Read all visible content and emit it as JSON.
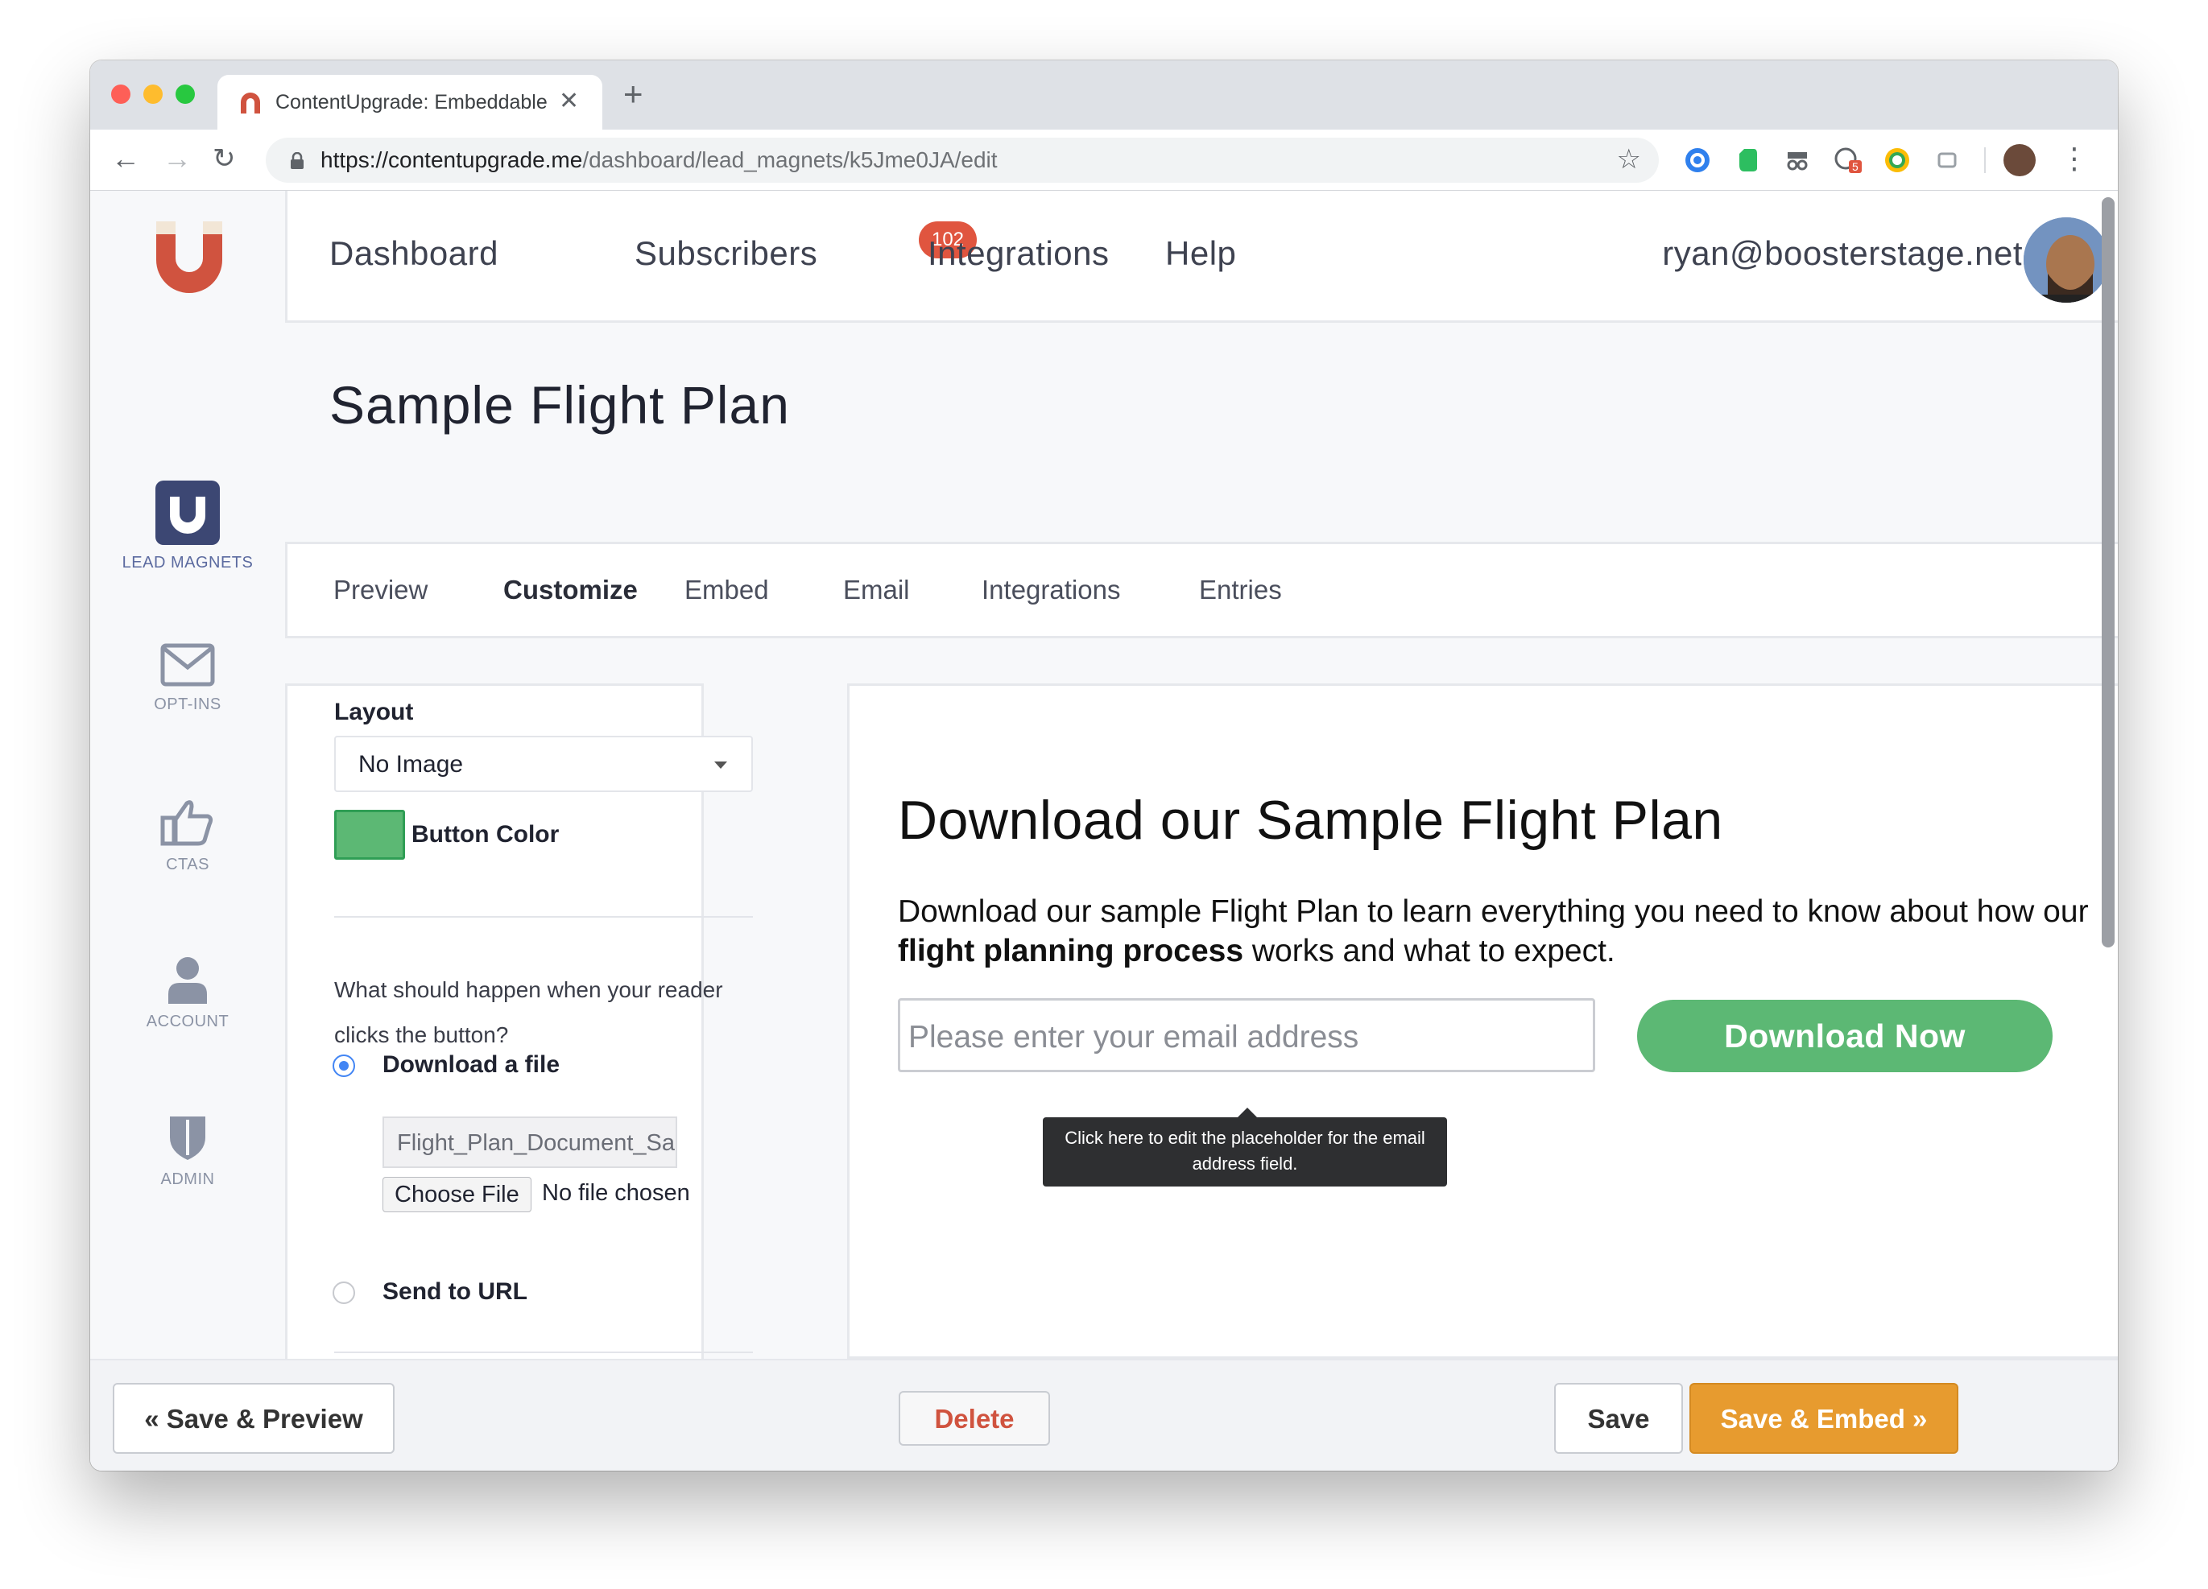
{
  "browser": {
    "tab_title": "ContentUpgrade: Embeddable",
    "url_host": "https://contentupgrade.me",
    "url_path": "/dashboard/lead_magnets/k5Jme0JA/edit",
    "extension_badge": "5"
  },
  "nav": {
    "dashboard": "Dashboard",
    "subscribers": "Subscribers",
    "subscribers_badge": "102",
    "integrations": "Integrations",
    "help": "Help",
    "user_email": "ryan@boosterstage.net"
  },
  "sidebar": {
    "items": [
      {
        "label": "LEAD MAGNETS",
        "icon": "magnet-icon"
      },
      {
        "label": "OPT-INS",
        "icon": "envelope-icon"
      },
      {
        "label": "CTAS",
        "icon": "thumbs-up-icon"
      },
      {
        "label": "ACCOUNT",
        "icon": "user-icon"
      },
      {
        "label": "ADMIN",
        "icon": "shield-icon"
      }
    ]
  },
  "page": {
    "title": "Sample Flight Plan",
    "tabs": [
      "Preview",
      "Customize",
      "Embed",
      "Email",
      "Integrations",
      "Entries"
    ],
    "active_tab": "Customize"
  },
  "settings": {
    "layout_label": "Layout",
    "layout_value": "No Image",
    "button_color_label": "Button Color",
    "button_color": "#5cb874",
    "question": "What should happen when your reader clicks the button?",
    "option_download": "Download a file",
    "file_value": "Flight_Plan_Document_Sa",
    "choose_file": "Choose File",
    "no_file": "No file chosen",
    "option_url": "Send to URL"
  },
  "preview": {
    "heading": "Download our Sample Flight Plan",
    "desc_before": "Download our sample Flight Plan to learn everything you need to know about how our ",
    "desc_bold": "flight planning process",
    "desc_after": " works and what to expect.",
    "email_placeholder": "Please enter your email address",
    "button_label": "Download Now",
    "tooltip": "Click here to edit the placeholder for the email address field."
  },
  "footer": {
    "save_preview": "« Save & Preview",
    "delete": "Delete",
    "save": "Save",
    "save_embed": "Save & Embed »"
  },
  "colors": {
    "accent_green": "#5cb874",
    "brand_red": "#d0533f",
    "orange": "#e79b2f",
    "badge_red": "#e0553f"
  }
}
